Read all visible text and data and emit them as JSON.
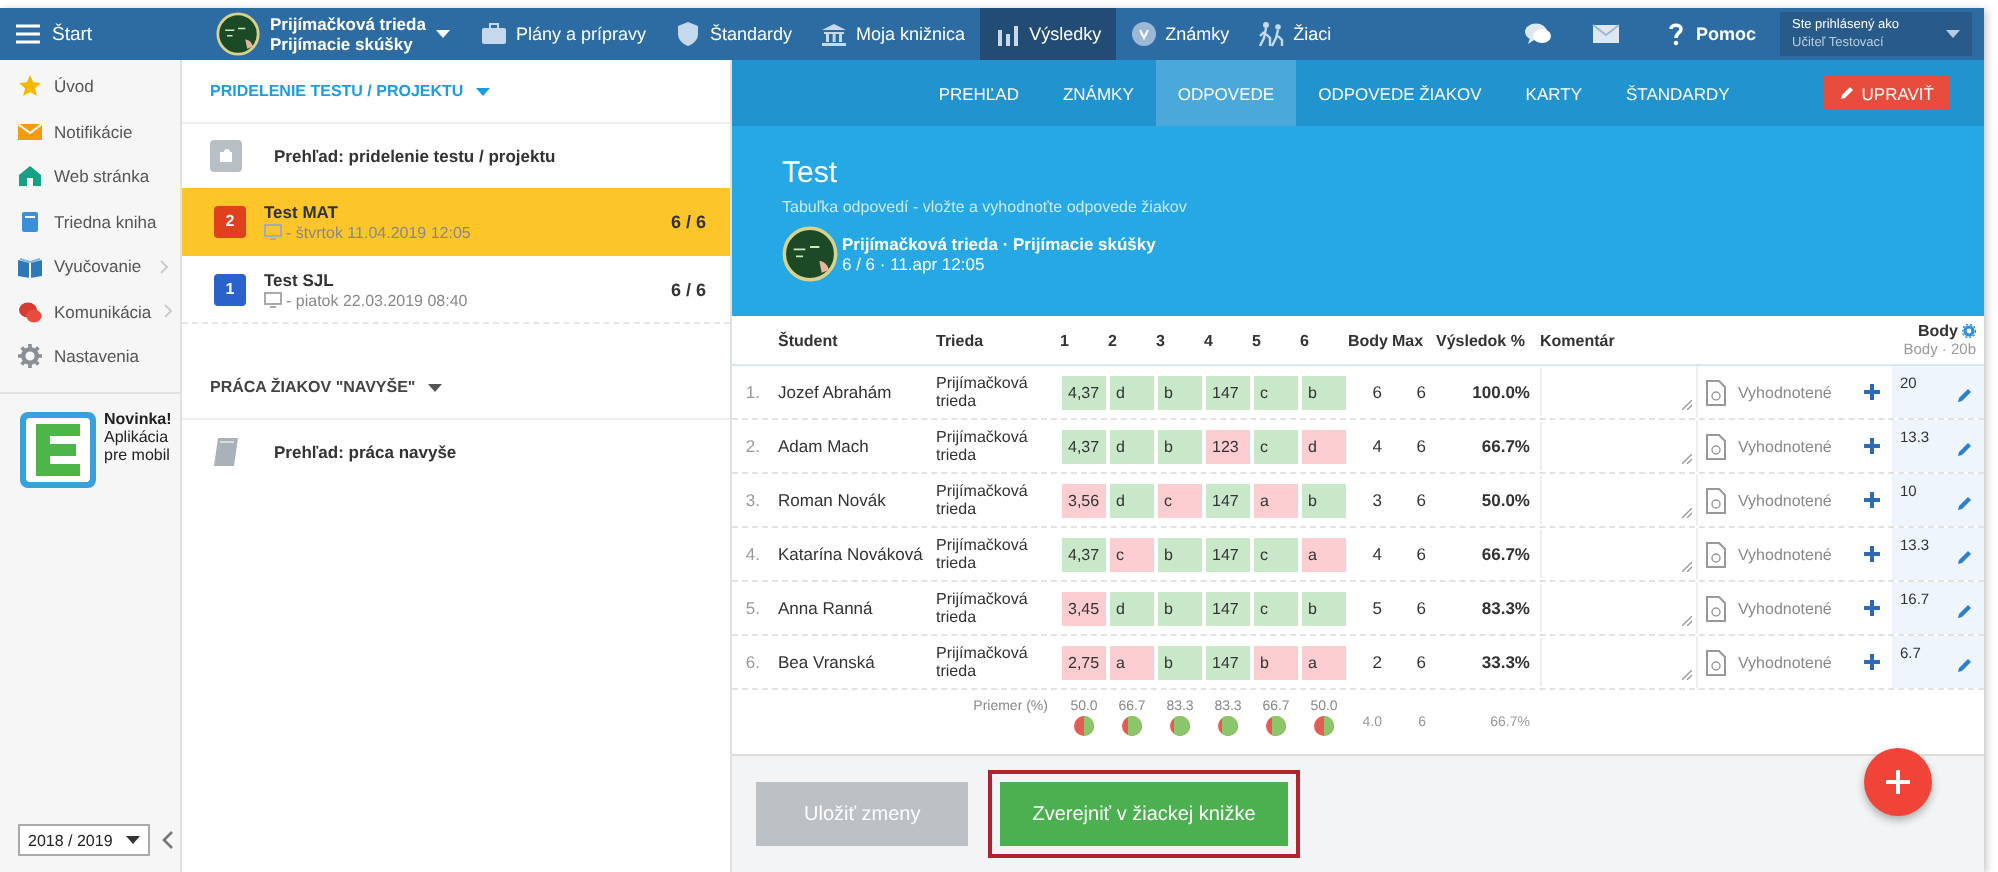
{
  "topbar": {
    "menu_label": "Štart",
    "class_name": "Prijímačková trieda",
    "class_subtitle": "Prijímacie skúšky",
    "nav": [
      {
        "label": "Plány a prípravy",
        "selected": false
      },
      {
        "label": "Štandardy",
        "selected": false
      },
      {
        "label": "Moja knižnica",
        "selected": false
      },
      {
        "label": "Výsledky",
        "selected": true
      },
      {
        "label": "Známky",
        "selected": false
      },
      {
        "label": "Žiaci",
        "selected": false
      }
    ],
    "help": "Pomoc",
    "user_caption": "Ste prihlásený ako",
    "user_name": "Učiteľ Testovací"
  },
  "sidebar": {
    "items": [
      {
        "label": "Úvod",
        "submenu": false
      },
      {
        "label": "Notifikácie",
        "submenu": false
      },
      {
        "label": "Web stránka",
        "submenu": false
      },
      {
        "label": "Triedna kniha",
        "submenu": false
      },
      {
        "label": "Vyučovanie",
        "submenu": true
      },
      {
        "label": "Komunikácia",
        "submenu": true
      },
      {
        "label": "Nastavenia",
        "submenu": false
      }
    ],
    "promo": {
      "title": "Novinka!",
      "lines": [
        "Aplikácia",
        "pre mobil"
      ]
    },
    "year": "2018 / 2019"
  },
  "assignments": {
    "title": "PRIDELENIE TESTU / PROJEKTU",
    "overview": "Prehľad: pridelenie testu / projektu",
    "tests": [
      {
        "badge": "2",
        "color": "#e0401c",
        "title": "Test MAT",
        "date": "- štvrtok 11.04.2019 12:05",
        "score": "6 / 6",
        "selected": true
      },
      {
        "badge": "1",
        "color": "#2a62cc",
        "title": "Test SJL",
        "date": "- piatok 22.03.2019 08:40",
        "score": "6 / 6",
        "selected": false
      }
    ]
  },
  "extra_work": {
    "title": "PRÁCA ŽIAKOV \"NAVYŠE\"",
    "overview": "Prehľad: práca navyše"
  },
  "main": {
    "tabs": [
      {
        "label": "PREHĽAD",
        "selected": false
      },
      {
        "label": "ZNÁMKY",
        "selected": false
      },
      {
        "label": "ODPOVEDE",
        "selected": true
      },
      {
        "label": "ODPOVEDE ŽIAKOV",
        "selected": false
      },
      {
        "label": "KARTY",
        "selected": false
      },
      {
        "label": "ŠTANDARDY",
        "selected": false
      }
    ],
    "edit_button": "UPRAVIŤ",
    "title": "Test",
    "subtitle": "Tabuľka odpovedí - vložte a vyhodnoťte odpovede žiakov",
    "class_line": "Prijímačková trieda · Prijímacie skúšky",
    "meta": "6 / 6 · 11.apr 12:05"
  },
  "table": {
    "columns": [
      "Študent",
      "Trieda",
      "1",
      "2",
      "3",
      "4",
      "5",
      "6",
      "Body",
      "Max",
      "Výsledok %",
      "Komentár"
    ],
    "points_column": {
      "title": "Body",
      "subtitle": "Body · 20b"
    },
    "rows": [
      {
        "number": "1.",
        "name": "Jozef Abrahám",
        "class": "Prijímačková trieda",
        "answers": [
          {
            "value": "4,37",
            "correct": true
          },
          {
            "value": "d",
            "correct": true
          },
          {
            "value": "b",
            "correct": true
          },
          {
            "value": "147",
            "correct": true
          },
          {
            "value": "c",
            "correct": true
          },
          {
            "value": "b",
            "correct": true
          }
        ],
        "body": "6",
        "max": "6",
        "result": "100.0%",
        "status": "Vyhodnotené",
        "points": "20"
      },
      {
        "number": "2.",
        "name": "Adam Mach",
        "class": "Prijímačková trieda",
        "answers": [
          {
            "value": "4,37",
            "correct": true
          },
          {
            "value": "d",
            "correct": true
          },
          {
            "value": "b",
            "correct": true
          },
          {
            "value": "123",
            "correct": false
          },
          {
            "value": "c",
            "correct": true
          },
          {
            "value": "d",
            "correct": false
          }
        ],
        "body": "4",
        "max": "6",
        "result": "66.7%",
        "status": "Vyhodnotené",
        "points": "13.3"
      },
      {
        "number": "3.",
        "name": "Roman Novák",
        "class": "Prijímačková trieda",
        "answers": [
          {
            "value": "3,56",
            "correct": false
          },
          {
            "value": "d",
            "correct": true
          },
          {
            "value": "c",
            "correct": false
          },
          {
            "value": "147",
            "correct": true
          },
          {
            "value": "a",
            "correct": false
          },
          {
            "value": "b",
            "correct": true
          }
        ],
        "body": "3",
        "max": "6",
        "result": "50.0%",
        "status": "Vyhodnotené",
        "points": "10"
      },
      {
        "number": "4.",
        "name": "Katarína Nováková",
        "class": "Prijímačková trieda",
        "answers": [
          {
            "value": "4,37",
            "correct": true
          },
          {
            "value": "c",
            "correct": false
          },
          {
            "value": "b",
            "correct": true
          },
          {
            "value": "147",
            "correct": true
          },
          {
            "value": "c",
            "correct": true
          },
          {
            "value": "a",
            "correct": false
          }
        ],
        "body": "4",
        "max": "6",
        "result": "66.7%",
        "status": "Vyhodnotené",
        "points": "13.3"
      },
      {
        "number": "5.",
        "name": "Anna Ranná",
        "class": "Prijímačková trieda",
        "answers": [
          {
            "value": "3,45",
            "correct": false
          },
          {
            "value": "d",
            "correct": true
          },
          {
            "value": "b",
            "correct": true
          },
          {
            "value": "147",
            "correct": true
          },
          {
            "value": "c",
            "correct": true
          },
          {
            "value": "b",
            "correct": true
          }
        ],
        "body": "5",
        "max": "6",
        "result": "83.3%",
        "status": "Vyhodnotené",
        "points": "16.7"
      },
      {
        "number": "6.",
        "name": "Bea Vranská",
        "class": "Prijímačková trieda",
        "answers": [
          {
            "value": "2,75",
            "correct": false
          },
          {
            "value": "a",
            "correct": false
          },
          {
            "value": "b",
            "correct": true
          },
          {
            "value": "147",
            "correct": true
          },
          {
            "value": "b",
            "correct": false
          },
          {
            "value": "a",
            "correct": false
          }
        ],
        "body": "2",
        "max": "6",
        "result": "33.3%",
        "status": "Vyhodnotené",
        "points": "6.7"
      }
    ],
    "average": {
      "label": "Priemer (%)",
      "values": [
        {
          "value": "50.0",
          "level": 0.5
        },
        {
          "value": "66.7",
          "level": 0.667
        },
        {
          "value": "83.3",
          "level": 0.833
        },
        {
          "value": "83.3",
          "level": 0.833
        },
        {
          "value": "66.7",
          "level": 0.667
        },
        {
          "value": "50.0",
          "level": 0.5
        }
      ],
      "body": "4.0",
      "max": "6",
      "result": "66.7%"
    }
  },
  "actions": {
    "save": {
      "label": "Uložiť zmeny",
      "disabled": true
    },
    "publish": {
      "label": "Zverejniť v žiackej knižke",
      "highlighted": true
    }
  }
}
